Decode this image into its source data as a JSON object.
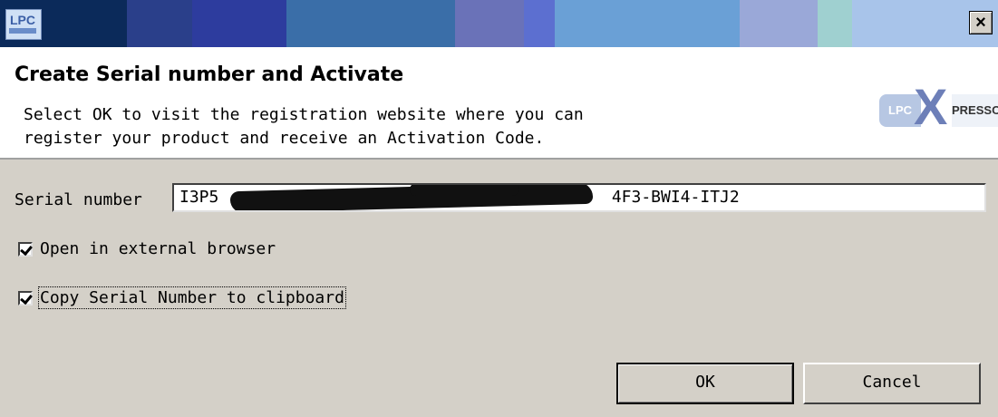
{
  "titlebar": {
    "colors": [
      "#0b2a5a",
      "#2a3f8a",
      "#2d3c9e",
      "#3a6ea8",
      "#6a72b8",
      "#5c6fd0",
      "#6aa0d6",
      "#8ab0e0",
      "#9aa8d8",
      "#9fd0d0",
      "#a8c4ea"
    ],
    "close_glyph": "×",
    "icon": "lpcxpresso-app-icon",
    "icon_text": "LPC"
  },
  "header": {
    "title": "Create Serial number and Activate",
    "description": "Select OK to visit the registration website where you can\nregister your product and receive an Activation Code.",
    "logo": {
      "lpc": "LPC",
      "x": "X",
      "presso": "PRESSO"
    }
  },
  "form": {
    "serial_label": "Serial number",
    "serial_value": "I3P5                                        4F3-BWI4-ITJ2",
    "open_browser_label": "Open in external browser",
    "open_browser_checked": true,
    "copy_serial_label": "Copy Serial Number to clipboard",
    "copy_serial_checked": true
  },
  "buttons": {
    "ok": "OK",
    "cancel": "Cancel"
  }
}
